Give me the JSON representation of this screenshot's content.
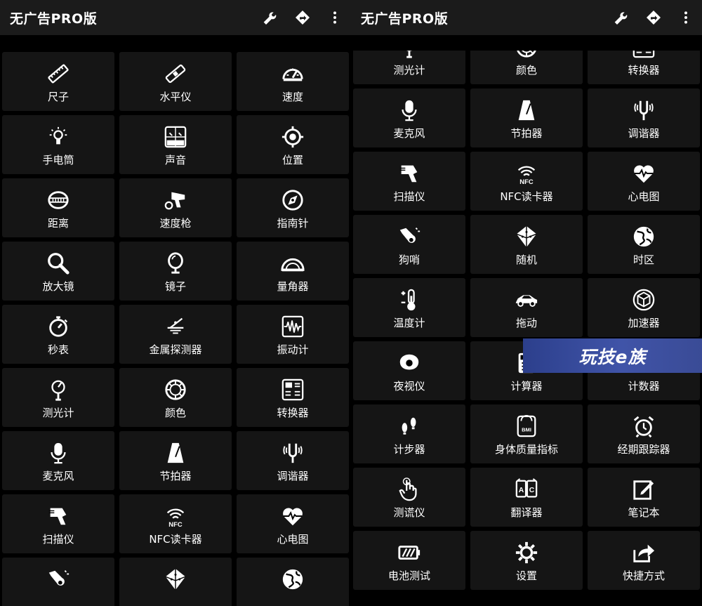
{
  "app": {
    "title": "无广告PRO版",
    "action_icons": [
      "wrench-icon",
      "navigation-diamond-icon",
      "more-vertical-icon"
    ]
  },
  "left_tiles": [
    {
      "label": "尺子",
      "icon": "ruler-icon"
    },
    {
      "label": "水平仪",
      "icon": "level-icon"
    },
    {
      "label": "速度",
      "icon": "speedometer-icon"
    },
    {
      "label": "手电筒",
      "icon": "flashlight-icon"
    },
    {
      "label": "声音",
      "icon": "sound-meter-icon"
    },
    {
      "label": "位置",
      "icon": "location-icon"
    },
    {
      "label": "距离",
      "icon": "distance-tape-icon"
    },
    {
      "label": "速度枪",
      "icon": "speed-gun-icon"
    },
    {
      "label": "指南针",
      "icon": "compass-icon"
    },
    {
      "label": "放大镜",
      "icon": "magnifier-icon"
    },
    {
      "label": "镜子",
      "icon": "mirror-icon"
    },
    {
      "label": "量角器",
      "icon": "protractor-icon"
    },
    {
      "label": "秒表",
      "icon": "stopwatch-icon"
    },
    {
      "label": "金属探测器",
      "icon": "metal-detector-icon"
    },
    {
      "label": "振动计",
      "icon": "vibration-icon"
    },
    {
      "label": "测光计",
      "icon": "light-meter-icon"
    },
    {
      "label": "颜色",
      "icon": "color-icon"
    },
    {
      "label": "转换器",
      "icon": "converter-icon"
    },
    {
      "label": "麦克风",
      "icon": "microphone-icon"
    },
    {
      "label": "节拍器",
      "icon": "metronome-icon"
    },
    {
      "label": "调谐器",
      "icon": "tuner-icon"
    },
    {
      "label": "扫描仪",
      "icon": "scanner-icon"
    },
    {
      "label": "NFC读卡器",
      "icon": "nfc-icon"
    },
    {
      "label": "心电图",
      "icon": "heart-rate-icon"
    },
    {
      "label": "",
      "icon": "dog-whistle-icon"
    },
    {
      "label": "",
      "icon": "random-dice-icon"
    },
    {
      "label": "",
      "icon": "globe-icon"
    }
  ],
  "right_tiles": [
    {
      "label": "测光计",
      "icon": "light-meter-icon"
    },
    {
      "label": "颜色",
      "icon": "color-icon"
    },
    {
      "label": "转换器",
      "icon": "converter-icon"
    },
    {
      "label": "麦克风",
      "icon": "microphone-icon"
    },
    {
      "label": "节拍器",
      "icon": "metronome-icon"
    },
    {
      "label": "调谐器",
      "icon": "tuner-icon"
    },
    {
      "label": "扫描仪",
      "icon": "scanner-icon"
    },
    {
      "label": "NFC读卡器",
      "icon": "nfc-icon"
    },
    {
      "label": "心电图",
      "icon": "heart-rate-icon"
    },
    {
      "label": "狗哨",
      "icon": "dog-whistle-icon"
    },
    {
      "label": "随机",
      "icon": "random-dice-icon"
    },
    {
      "label": "时区",
      "icon": "globe-icon"
    },
    {
      "label": "温度计",
      "icon": "thermometer-icon"
    },
    {
      "label": "拖动",
      "icon": "car-icon"
    },
    {
      "label": "加速器",
      "icon": "accelerometer-icon"
    },
    {
      "label": "夜视仪",
      "icon": "night-vision-icon"
    },
    {
      "label": "计算器",
      "icon": "calculator-icon"
    },
    {
      "label": "计数器",
      "icon": "counter-icon"
    },
    {
      "label": "计步器",
      "icon": "pedometer-icon"
    },
    {
      "label": "身体质量指标",
      "icon": "bmi-icon"
    },
    {
      "label": "经期跟踪器",
      "icon": "alarm-clock-icon"
    },
    {
      "label": "测谎仪",
      "icon": "lie-detector-icon"
    },
    {
      "label": "翻译器",
      "icon": "translator-icon"
    },
    {
      "label": "笔记本",
      "icon": "notepad-icon"
    },
    {
      "label": "电池测试",
      "icon": "battery-icon"
    },
    {
      "label": "设置",
      "icon": "settings-gear-icon"
    },
    {
      "label": "快捷方式",
      "icon": "shortcut-share-icon"
    }
  ],
  "watermark": {
    "text": "玩技e族"
  }
}
